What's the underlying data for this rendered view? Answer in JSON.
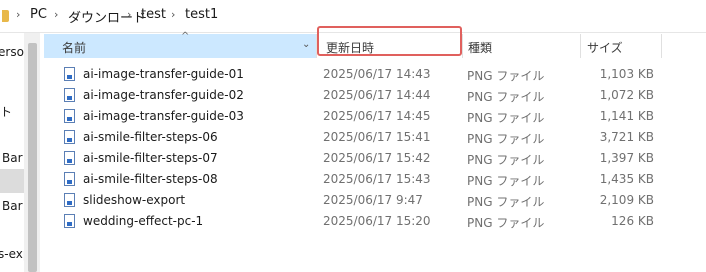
{
  "address_bar": {
    "crumbs": [
      "PC",
      "ダウンロード",
      "test",
      "test1"
    ]
  },
  "nav_pane": {
    "items": [
      "erson",
      "ト",
      "Bar",
      "Bar",
      "s-exp"
    ]
  },
  "columns": {
    "name": "名前",
    "date": "更新日時",
    "type": "種類",
    "size": "サイズ"
  },
  "files": [
    {
      "name": "ai-image-transfer-guide-01",
      "date": "2025/06/17 14:43",
      "type": "PNG ファイル",
      "size": "1,103 KB"
    },
    {
      "name": "ai-image-transfer-guide-02",
      "date": "2025/06/17 14:44",
      "type": "PNG ファイル",
      "size": "1,072 KB"
    },
    {
      "name": "ai-image-transfer-guide-03",
      "date": "2025/06/17 14:45",
      "type": "PNG ファイル",
      "size": "1,141 KB"
    },
    {
      "name": "ai-smile-filter-steps-06",
      "date": "2025/06/17 15:41",
      "type": "PNG ファイル",
      "size": "3,721 KB"
    },
    {
      "name": "ai-smile-filter-steps-07",
      "date": "2025/06/17 15:42",
      "type": "PNG ファイル",
      "size": "1,397 KB"
    },
    {
      "name": "ai-smile-filter-steps-08",
      "date": "2025/06/17 15:43",
      "type": "PNG ファイル",
      "size": "1,435 KB"
    },
    {
      "name": "slideshow-export",
      "date": "2025/06/17 9:47",
      "type": "PNG ファイル",
      "size": "2,109 KB"
    },
    {
      "name": "wedding-effect-pc-1",
      "date": "2025/06/17 15:20",
      "type": "PNG ファイル",
      "size": "126 KB"
    }
  ]
}
